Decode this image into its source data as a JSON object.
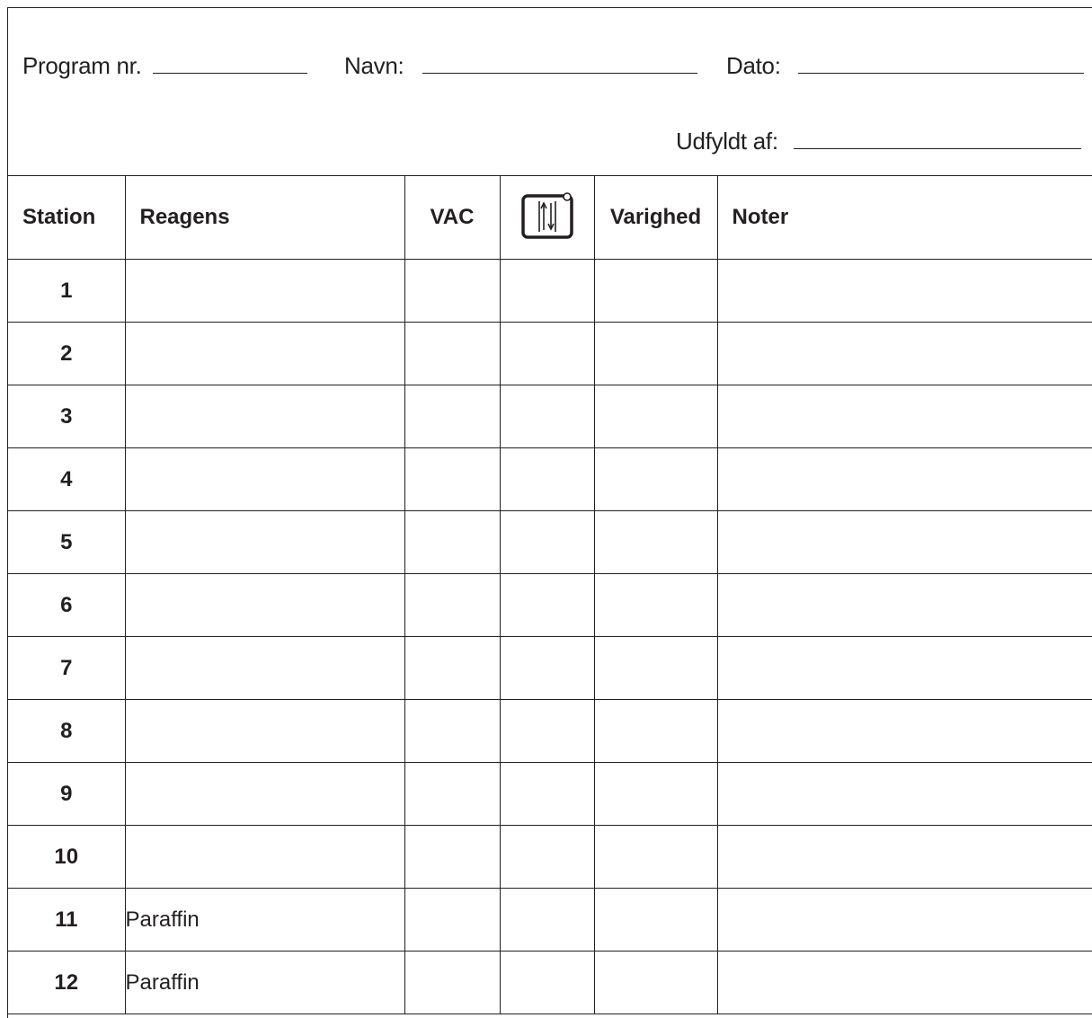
{
  "header": {
    "program_label": "Program nr.",
    "navn_label": "Navn:",
    "dato_label": "Dato:",
    "udfyldt_label": "Udfyldt af:"
  },
  "table": {
    "columns": {
      "station": "Station",
      "reagens": "Reagens",
      "vac": "VAC",
      "agitation_icon": "agitation-icon",
      "varighed": "Varighed",
      "noter": "Noter"
    },
    "rows": [
      {
        "station": "1",
        "reagens": ""
      },
      {
        "station": "2",
        "reagens": ""
      },
      {
        "station": "3",
        "reagens": ""
      },
      {
        "station": "4",
        "reagens": ""
      },
      {
        "station": "5",
        "reagens": ""
      },
      {
        "station": "6",
        "reagens": ""
      },
      {
        "station": "7",
        "reagens": ""
      },
      {
        "station": "8",
        "reagens": ""
      },
      {
        "station": "9",
        "reagens": ""
      },
      {
        "station": "10",
        "reagens": ""
      },
      {
        "station": "11",
        "reagens": "Paraffin"
      },
      {
        "station": "12",
        "reagens": "Paraffin"
      }
    ]
  }
}
